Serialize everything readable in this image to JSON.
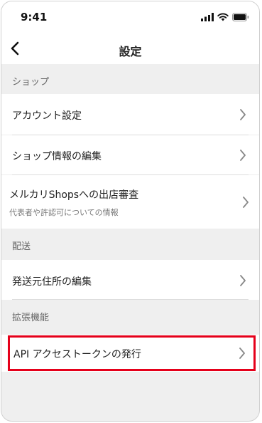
{
  "status_bar": {
    "time": "9:41"
  },
  "nav": {
    "title": "設定",
    "back_icon": "chevron-left-icon"
  },
  "sections": [
    {
      "header": "ショップ",
      "items": [
        {
          "label": "アカウント設定"
        },
        {
          "label": "ショップ情報の編集"
        },
        {
          "label": "メルカリShopsへの出店審査",
          "sublabel": "代表者や許認可についての情報"
        }
      ]
    },
    {
      "header": "配送",
      "items": [
        {
          "label": "発送元住所の編集"
        }
      ]
    },
    {
      "header": "拡張機能",
      "items": [
        {
          "label": "API アクセストークンの発行"
        }
      ]
    }
  ],
  "colors": {
    "highlight": "#e5001a",
    "background": "#efefef"
  }
}
